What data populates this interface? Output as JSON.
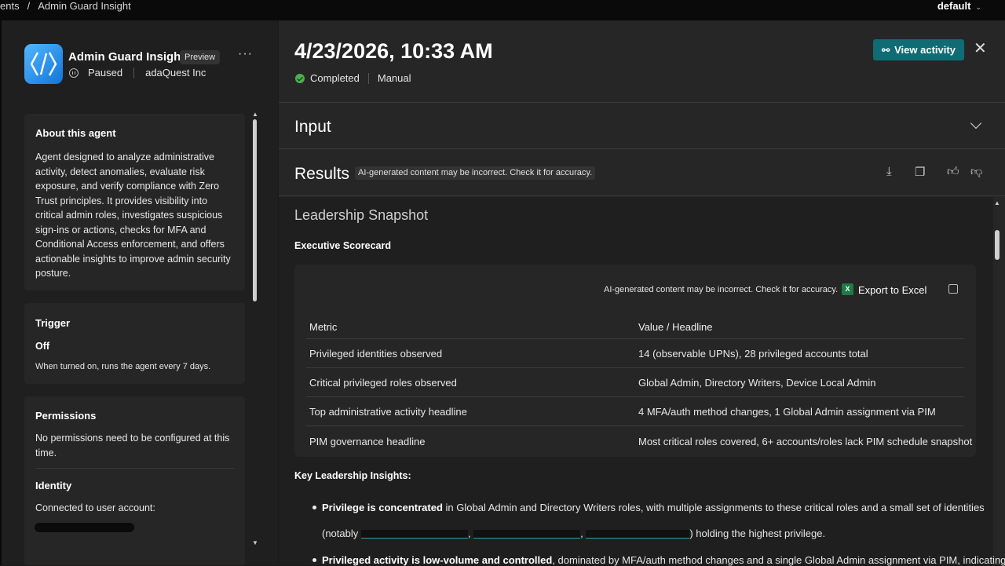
{
  "topbar": {
    "breadcrumb": [
      "ents",
      "/",
      "Admin Guard Insight"
    ],
    "environment": "default"
  },
  "agent": {
    "name": "Admin Guard Insight",
    "badge": "Preview",
    "more": "···",
    "status": "Paused",
    "org": "adaQuest Inc"
  },
  "about": {
    "title": "About this agent",
    "lines": [
      "Agent designed to analyze administrative",
      "activity, detect anomalies, evaluate risk",
      "exposure, and verify compliance with Zero",
      "Trust principles. It provides visibility into",
      "critical admin roles, investigates suspicious",
      "sign-ins or actions, checks for MFA and",
      "Conditional Access enforcement, and offers",
      "actionable insights to improve admin security",
      "posture."
    ]
  },
  "trigger": {
    "title": "Trigger",
    "value": "Off",
    "desc": "When turned on, runs the agent every 7 days."
  },
  "permissions": {
    "title": "Permissions",
    "lines": [
      "No permissions need to be configured at this",
      "time."
    ]
  },
  "identity": {
    "title": "Identity",
    "text": "Connected to user account:"
  },
  "run": {
    "title": "4/23/2026, 10:33 AM",
    "status": "Completed",
    "mode": "Manual",
    "view_activity": "View activity",
    "close": "✕"
  },
  "sections": {
    "input": "Input",
    "results": "Results",
    "ai_note": "AI-generated content may be incorrect. Check it for accuracy."
  },
  "report": {
    "heading": "Leadership Snapshot",
    "scorecard_title": "Executive Scorecard",
    "table_note": "AI-generated content may be incorrect. Check it for accuracy.",
    "export": "Export to Excel",
    "excel_icon": "X",
    "columns": [
      "Metric",
      "Value / Headline"
    ],
    "rows": [
      [
        "Privileged identities observed",
        "14 (observable UPNs), 28 privileged accounts total"
      ],
      [
        "Critical privileged roles observed",
        "Global Admin, Directory Writers, Device Local Admin"
      ],
      [
        "Top administrative activity headline",
        "4 MFA/auth method changes, 1 Global Admin assignment via PIM"
      ],
      [
        "PIM governance headline",
        "Most critical roles covered, 6+ accounts/roles lack PIM schedule snapshot"
      ]
    ],
    "insights_title": "Key Leadership Insights:",
    "insight1_bold": "Privilege is concentrated",
    "insight1_text": " in Global Admin and Directory Writers roles, with multiple assignments to these critical roles and a small set of identities",
    "insight1_line2_pre": "(notably ",
    "insight1_line2_post": ") holding the highest privilege.",
    "insight1_sep": ", ",
    "insight2_bold": "Privileged activity is low-volume and controlled",
    "insight2_text": ", dominated by MFA/auth method changes and a single Global Admin assignment via PIM, indicating"
  }
}
